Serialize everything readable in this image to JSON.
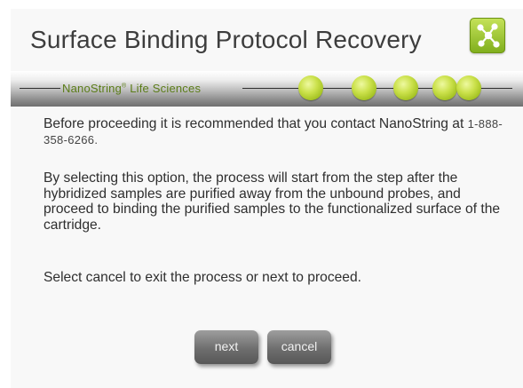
{
  "header": {
    "title": "Surface Binding Protocol Recovery",
    "logo_icon": "network-nodes-icon",
    "logo_color": "#8dbb24"
  },
  "banner": {
    "brand_name": "NanoString",
    "brand_mark": "®",
    "brand_suffix": "Life Sciences",
    "brand_color": "#5a7c17",
    "progress_dots": 5
  },
  "message": {
    "para1_text": "Before proceeding it is recommended that you contact NanoString at ",
    "para1_phone": "1-888-358-6266.",
    "para2": "By selecting this option, the process will start from the step after the hybridized samples are purified away from the unbound probes, and proceed to binding the purified samples to the functionalized surface of the cartridge.",
    "para3": "Select cancel to exit the process or next to proceed."
  },
  "buttons": {
    "next_label": "next",
    "cancel_label": "cancel"
  }
}
